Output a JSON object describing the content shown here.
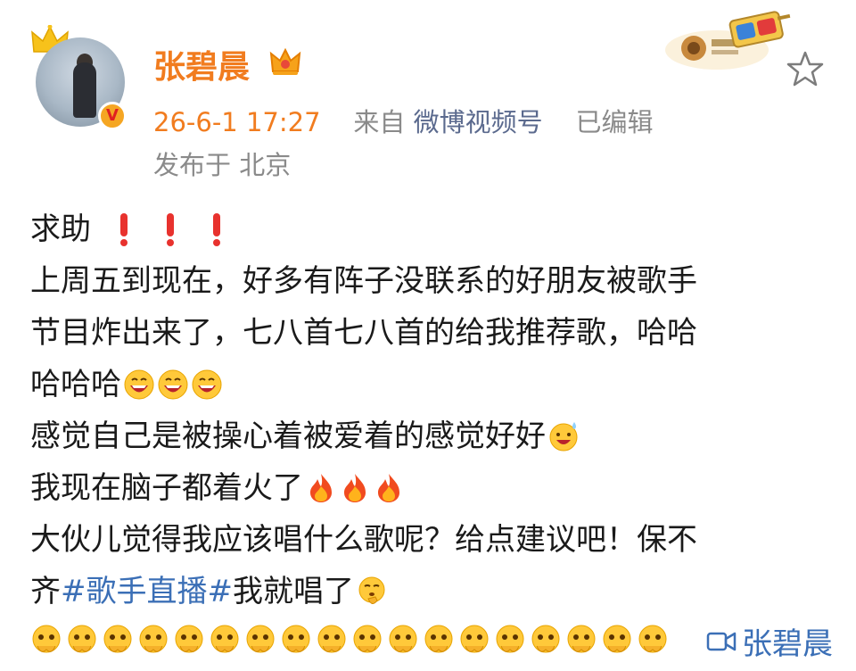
{
  "author": {
    "name": "张碧晨",
    "verified": true
  },
  "post_meta": {
    "time": "26-6-1 17:27",
    "from_label": "来自",
    "source": "微博视频号",
    "edited": "已编辑",
    "location_label": "发布于",
    "location": "北京"
  },
  "content": {
    "line1": "求助",
    "line2": "上周五到现在，好多有阵子没联系的好朋友被歌手",
    "line3": "节目炸出来了，七八首七八首的给我推荐歌，哈哈",
    "line4": "哈哈哈",
    "line5": "感觉自己是被操心着被爱着的感觉好好",
    "line6": "我现在脑子都着火了",
    "line7": "大伙儿觉得我应该唱什么歌呢？给点建议吧！保不",
    "line8_pre": "齐",
    "line8_topic": "#歌手直播#",
    "line8_post": " 我就唱了",
    "video_tag": "张碧晨"
  },
  "colors": {
    "accent_orange": "#f17c1f",
    "link_blue": "#3b6fb6",
    "meta_gray": "#8a8a8a"
  },
  "icons": {
    "favorite": "star-icon",
    "verified": "verified-v-icon",
    "video": "video-camera-icon"
  }
}
